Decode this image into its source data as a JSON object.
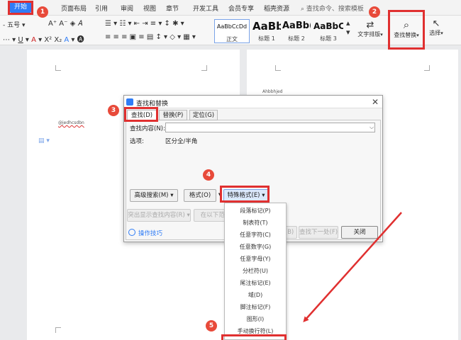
{
  "menubar": {
    "start": "开始",
    "items": [
      "页面布局",
      "引用",
      "审阅",
      "视图",
      "章节",
      "开发工具",
      "会员专享",
      "稻壳资源"
    ],
    "search_placeholder": "查找命令、搜索模板"
  },
  "ribbon": {
    "font_size": "五号",
    "styles": [
      {
        "preview": "AaBbCcDd",
        "label": "正文"
      },
      {
        "preview": "AaBb",
        "label": "标题 1"
      },
      {
        "preview": "AaBb(",
        "label": "标题 2"
      },
      {
        "preview": "AaBbC",
        "label": "标题 3"
      }
    ],
    "text_layout": "文字排版",
    "find_replace": "查找替换",
    "select": "选择"
  },
  "document": {
    "left_text": "@jedhcsdbn",
    "right_text": "Ahbbhjed"
  },
  "dialog": {
    "title": "查找和替换",
    "tabs": [
      "查找(D)",
      "替换(P)",
      "定位(G)"
    ],
    "find_label": "查找内容(N):",
    "options_label": "选项:",
    "options_value": "区分全/半角",
    "buttons": {
      "advanced": "高级搜索(M) ▾",
      "format": "格式(O)",
      "special": "特殊格式(E) ▾",
      "highlight": "突出显示查找内容(R) ▾",
      "find_in": "在以下范围",
      "prev": "(B)",
      "next": "查找下一处(F)",
      "close": "关闭"
    },
    "tips": "操作技巧"
  },
  "special_menu": {
    "items": [
      "段落标记(P)",
      "制表符(T)",
      "任意字符(C)",
      "任意数字(G)",
      "任意字母(Y)",
      "分栏符(U)",
      "尾注标记(E)",
      "域(D)",
      "脚注标记(F)",
      "图形(I)",
      "手动换行符(L)"
    ]
  },
  "annotations": {
    "markers": [
      "1",
      "2",
      "3",
      "4",
      "5"
    ],
    "color": "#e03030"
  }
}
